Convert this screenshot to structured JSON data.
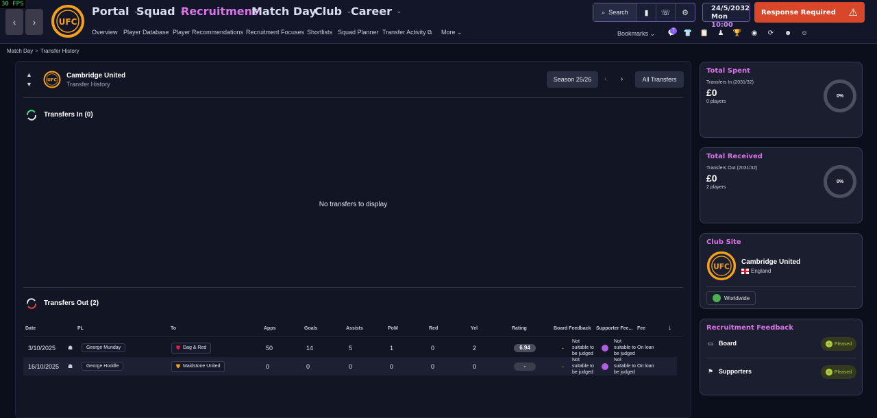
{
  "fps": "30 FPS",
  "nav": {
    "main": [
      {
        "label": "Portal"
      },
      {
        "label": "Squad"
      },
      {
        "label": "Recruitment"
      },
      {
        "label": "Match Day"
      },
      {
        "label": "Club"
      },
      {
        "label": "Career"
      }
    ],
    "sub": [
      "Overview",
      "Player Database",
      "Player Recommendations",
      "Recruitment Focuses",
      "Shortlists",
      "Squad Planner",
      "Transfer Activity",
      "More"
    ],
    "search_label": "Search",
    "date": "24/5/2032",
    "day": "Mon",
    "time": "10:00",
    "response_label": "Response Required",
    "bookmarks_label": "Bookmarks",
    "notification_count": "7"
  },
  "breadcrumb": [
    "Match Day",
    "Transfer History"
  ],
  "club": {
    "name": "Cambridge United",
    "subtitle": "Transfer History",
    "country": "England",
    "crest_initials": "CUFC"
  },
  "controls": {
    "season": "Season 25/26",
    "all_transfers": "All Transfers"
  },
  "transfers_in": {
    "title": "Transfers In (0)",
    "empty_message": "No transfers to display"
  },
  "transfers_out": {
    "title": "Transfers Out (2)",
    "columns": [
      "Date",
      "PL",
      "To",
      "Apps",
      "Goals",
      "Assists",
      "PoM",
      "Red",
      "Yel",
      "Rating",
      "Board Feedback",
      "Supporter Fee...",
      "Fee"
    ],
    "rows": [
      {
        "date": "3/10/2025",
        "player": "George Munday",
        "to": "Dag & Red",
        "apps": "50",
        "goals": "14",
        "assists": "5",
        "pom": "1",
        "red": "0",
        "yel": "2",
        "rating": "6.94",
        "board": "-",
        "board_note": "Not suitable to be judged",
        "supporter_note": "Not suitable to be judged",
        "fee": "On loan"
      },
      {
        "date": "16/10/2025",
        "player": "George Hoddle",
        "to": "Maidstone United",
        "apps": "0",
        "goals": "0",
        "assists": "0",
        "pom": "0",
        "red": "0",
        "yel": "0",
        "rating": "-",
        "board": "-",
        "board_note": "Not suitable to be judged",
        "supporter_note": "Not suitable to be judged",
        "fee": "On loan"
      }
    ]
  },
  "total_spent": {
    "title": "Total Spent",
    "sub": "Transfers In (2031/32)",
    "value": "£0",
    "players": "0 players",
    "percent": "0%"
  },
  "total_received": {
    "title": "Total Received",
    "sub": "Transfers Out (2031/32)",
    "value": "£0",
    "players": "2 players",
    "percent": "0%"
  },
  "club_site": {
    "title": "Club Site",
    "tag": "Worldwide"
  },
  "recruitment_feedback": {
    "title": "Recruitment Feedback",
    "board_label": "Board",
    "board_status": "Pleased",
    "supporters_label": "Supporters",
    "supporters_status": "Pleased"
  },
  "colors": {
    "accent_purple": "#d874e6",
    "alert": "#d9472b",
    "crest": "#f3a01c",
    "pleased": "#b5d341"
  }
}
